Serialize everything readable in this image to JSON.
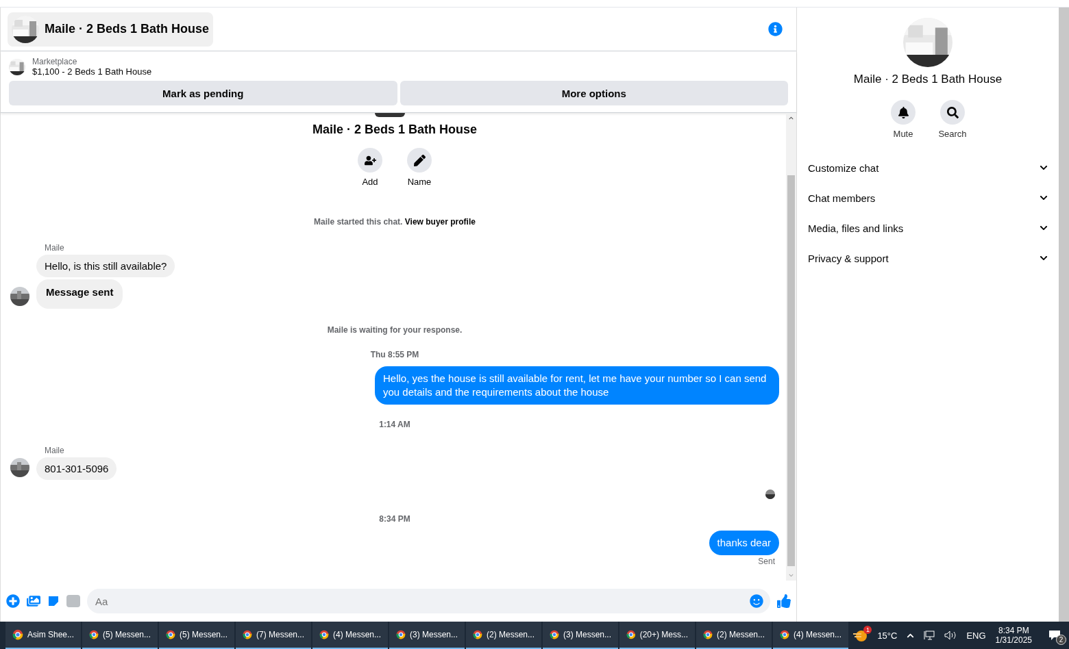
{
  "header": {
    "title": "Maile · 2 Beds 1 Bath House"
  },
  "listing": {
    "source": "Marketplace",
    "title": "$1,100 - 2 Beds 1 Bath House",
    "actions": [
      "Mark as pending",
      "More options"
    ]
  },
  "intro": {
    "title": "Maile · 2 Beds 1 Bath House",
    "actions": [
      {
        "kind": "add",
        "label": "Add"
      },
      {
        "kind": "name",
        "label": "Name"
      }
    ]
  },
  "feed": [
    {
      "kind": "system",
      "text": "Maile started this chat. ",
      "link": "View buyer profile"
    },
    {
      "kind": "sender",
      "text": "Maile"
    },
    {
      "kind": "incoming",
      "text": "Hello, is this still available?",
      "bold": false,
      "show_avatar": false
    },
    {
      "kind": "incoming",
      "text": "Message sent",
      "bold": true,
      "show_avatar": true
    },
    {
      "kind": "system",
      "text": "Maile is waiting for your response."
    },
    {
      "kind": "time",
      "text": "Thu 8:55 PM"
    },
    {
      "kind": "outgoing",
      "text": "Hello, yes the house is still available for rent, let me have your number so I can send you details and the requirements about the house"
    },
    {
      "kind": "time",
      "text": "1:14 AM"
    },
    {
      "kind": "sender",
      "text": "Maile"
    },
    {
      "kind": "incoming",
      "text": "801-301-5096",
      "bold": false,
      "show_avatar": true
    },
    {
      "kind": "seen"
    },
    {
      "kind": "time",
      "text": "8:34 PM"
    },
    {
      "kind": "outgoing",
      "text": "thanks dear"
    },
    {
      "kind": "status",
      "text": "Sent"
    }
  ],
  "composer": {
    "placeholder": "Aa"
  },
  "details": {
    "title": "Maile · 2 Beds 1 Bath House",
    "actions": [
      {
        "kind": "mute",
        "label": "Mute"
      },
      {
        "kind": "search",
        "label": "Search"
      }
    ],
    "sections": [
      {
        "label": "Customize chat",
        "expanded": false
      },
      {
        "label": "Chat members",
        "expanded": false
      },
      {
        "label": "Media, files and links",
        "expanded": false
      },
      {
        "label": "Privacy & support",
        "expanded": false
      }
    ]
  },
  "taskbar": {
    "apps": [
      {
        "label": "Asim Shee..."
      },
      {
        "label": "(5) Messen..."
      },
      {
        "label": "(5) Messen..."
      },
      {
        "label": "(7) Messen..."
      },
      {
        "label": "(4) Messen..."
      },
      {
        "label": "(3) Messen..."
      },
      {
        "label": "(2) Messen..."
      },
      {
        "label": "(3) Messen..."
      },
      {
        "label": "(20+) Mess..."
      },
      {
        "label": "(2) Messen..."
      },
      {
        "label": "(4) Messen..."
      }
    ],
    "weather_badge": "1",
    "temperature": "15°C",
    "language": "ENG",
    "time": "8:34 PM",
    "date": "1/31/2025",
    "notifications": "2"
  }
}
